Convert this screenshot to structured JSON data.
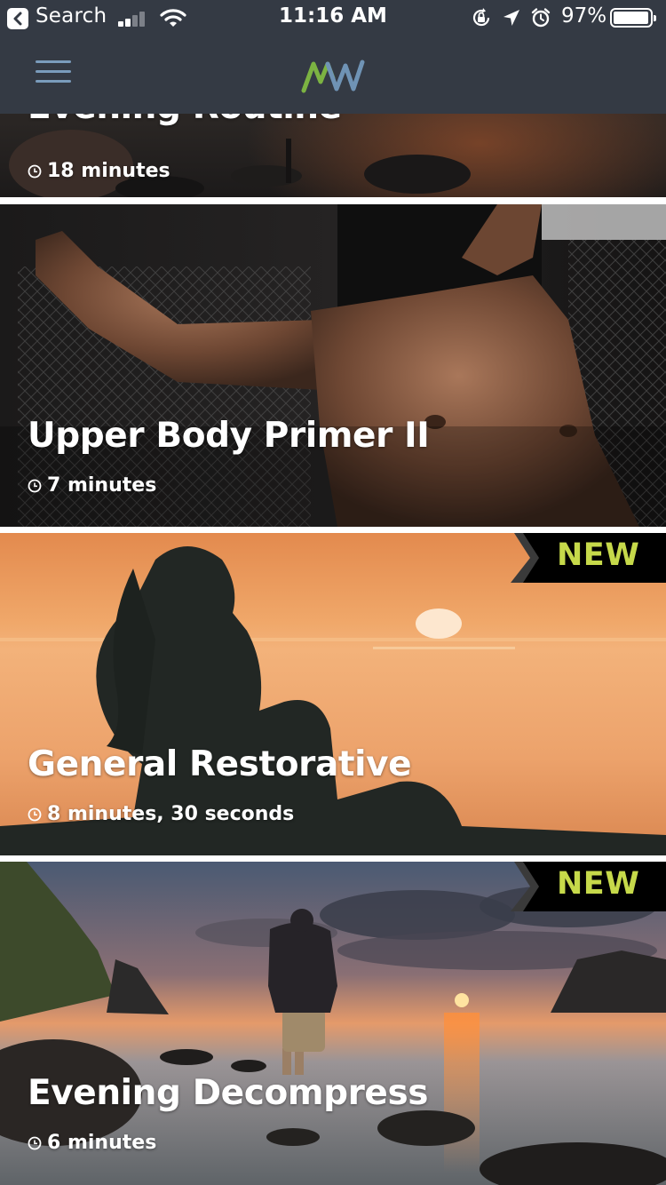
{
  "status_bar": {
    "back_label": "Search",
    "time": "11:16 AM",
    "battery_percent": "97%",
    "battery_level": 0.97
  },
  "nav": {
    "menu_icon": "hamburger-icon",
    "logo_icon": "mw-logo",
    "logo_colors": {
      "m": "#7cb342",
      "w": "#6f93b5"
    }
  },
  "workouts": [
    {
      "title": "Evening Routine",
      "duration": "18 minutes",
      "is_new": false
    },
    {
      "title": "Upper Body Primer II",
      "duration": "7 minutes",
      "is_new": false
    },
    {
      "title": "General Restorative",
      "duration": "8 minutes, 30 seconds",
      "is_new": true,
      "badge": "NEW"
    },
    {
      "title": "Evening Decompress",
      "duration": "6 minutes",
      "is_new": true,
      "badge": "NEW"
    }
  ],
  "colors": {
    "header_bg": "#343a44",
    "badge_text": "#c6d94a",
    "badge_bg": "#000000"
  }
}
